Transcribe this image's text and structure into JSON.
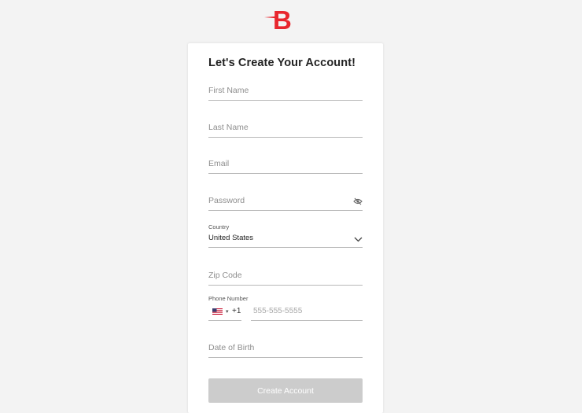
{
  "brand": {
    "logo_letter": "B",
    "accent_color": "#e8262e"
  },
  "form": {
    "title": "Let's Create Your Account!",
    "first_name_placeholder": "First Name",
    "last_name_placeholder": "Last Name",
    "email_placeholder": "Email",
    "password_placeholder": "Password",
    "password_toggle_icon": "eye-slash-icon",
    "country_label": "Country",
    "country_value": "United States",
    "country_dropdown_icon": "chevron-down-icon",
    "zip_placeholder": "Zip Code",
    "phone_label": "Phone Number",
    "phone_flag_icon": "us-flag-icon",
    "phone_dial_code": "+1",
    "phone_placeholder": "555-555-5555",
    "dob_placeholder": "Date of Birth",
    "submit_label": "Create Account",
    "submit_disabled_color": "#cccccc"
  }
}
